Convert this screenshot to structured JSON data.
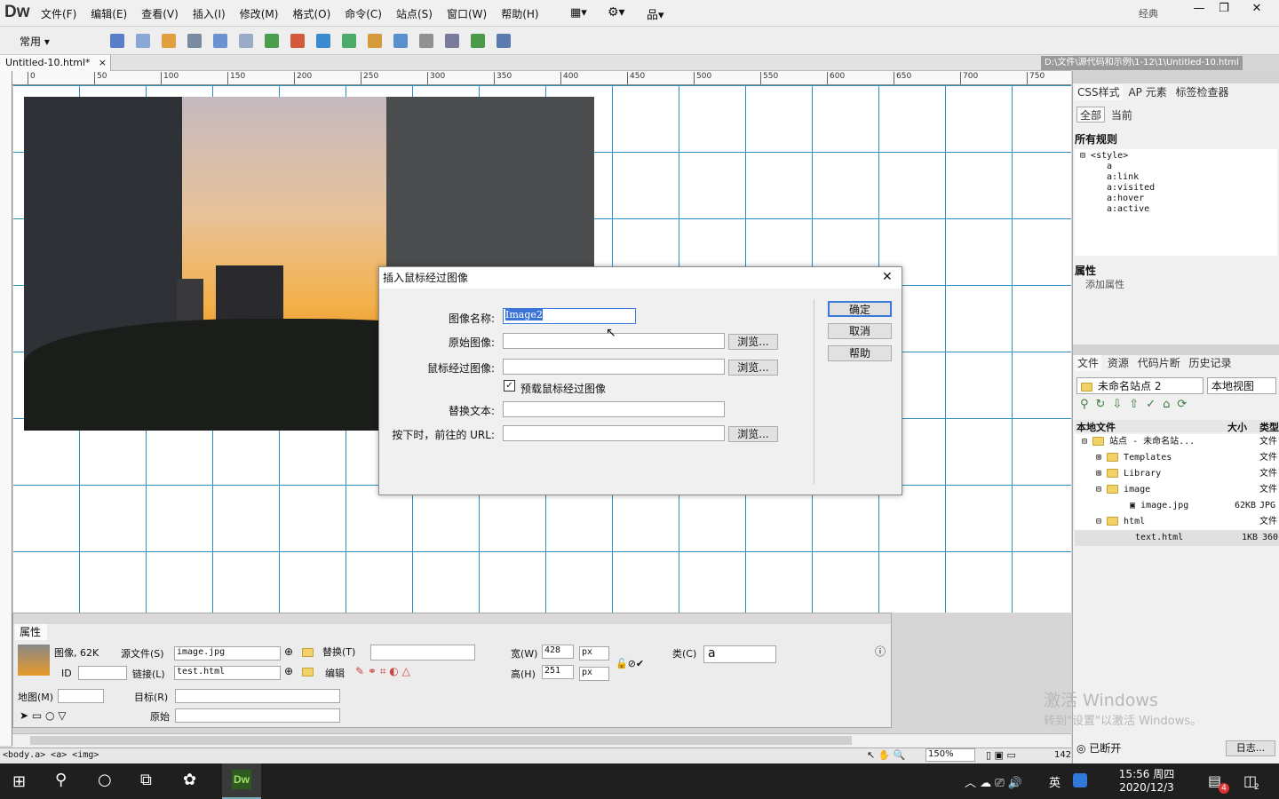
{
  "app": {
    "logo": "Dw",
    "layout": "经典",
    "win_min": "—",
    "win_max": "❐",
    "win_close": "✕"
  },
  "menu": [
    "文件(F)",
    "编辑(E)",
    "查看(V)",
    "插入(I)",
    "修改(M)",
    "格式(O)",
    "命令(C)",
    "站点(S)",
    "窗口(W)",
    "帮助(H)"
  ],
  "toolbar": {
    "category": "常用"
  },
  "document": {
    "tab": "Untitled-10.html*",
    "tab_close": "×",
    "path": "D:\\文件\\源代码和示例\\1-12\\1\\Untitled-10.html"
  },
  "ruler": [
    "0",
    "50",
    "100",
    "150",
    "200",
    "250",
    "300",
    "350",
    "400",
    "450",
    "500",
    "550",
    "600",
    "650",
    "700",
    "750"
  ],
  "dialog": {
    "title": "插入鼠标经过图像",
    "close": "✕",
    "fields": {
      "name_label": "图像名称:",
      "name_value": "Image2",
      "orig_label": "原始图像:",
      "over_label": "鼠标经过图像:",
      "preload_label": "预载鼠标经过图像",
      "alt_label": "替换文本:",
      "url_label": "按下时，前往的 URL:"
    },
    "browse": "浏览...",
    "ok": "确定",
    "cancel": "取消",
    "help": "帮助"
  },
  "props": {
    "title": "属性",
    "img_info": "图像, 62K",
    "src_label": "源文件(S)",
    "src": "image.jpg",
    "alt_label": "替换(T)",
    "w_label": "宽(W)",
    "w": "428",
    "h_label": "高(H)",
    "h": "251",
    "unit": "px",
    "class_label": "类(C)",
    "class": "a",
    "id_label": "ID",
    "link_label": "链接(L)",
    "link": "test.html",
    "edit_label": "编辑",
    "map_label": "地图(M)",
    "target_label": "目标(R)",
    "orig_label": "原始"
  },
  "css_panel": {
    "tabs": [
      "CSS样式",
      "AP 元素",
      "标签检查器"
    ],
    "mode": [
      "全部",
      "当前"
    ],
    "all_rules": "所有规则",
    "rules": [
      "<style>",
      "a",
      "a:link",
      "a:visited",
      "a:hover",
      "a:active"
    ],
    "props": "属性",
    "add_prop": "添加属性"
  },
  "files_panel": {
    "tabs": [
      "文件",
      "资源",
      "代码片断",
      "历史记录"
    ],
    "site": "未命名站点 2",
    "view": "本地视图",
    "headers": [
      "本地文件",
      "大小",
      "类型"
    ],
    "tree": [
      {
        "name": "站点 - 未命名站...",
        "size": "",
        "type": "文件"
      },
      {
        "name": "Templates",
        "size": "",
        "type": "文件"
      },
      {
        "name": "Library",
        "size": "",
        "type": "文件"
      },
      {
        "name": "image",
        "size": "",
        "type": "文件"
      },
      {
        "name": "image.jpg",
        "size": "62KB",
        "type": "JPG"
      },
      {
        "name": "html",
        "size": "",
        "type": "文件"
      },
      {
        "name": "text.html",
        "size": "1KB",
        "type": "360"
      }
    ],
    "status": "已断开",
    "log": "日志..."
  },
  "status": {
    "tags": "<body.a> <a> <img>",
    "zoom": "150%",
    "dims": "142"
  },
  "watermark": {
    "line1": "激活 Windows",
    "line2": "转到\"设置\"以激活 Windows。"
  },
  "taskbar": {
    "time": "15:56 周四",
    "date": "2020/12/3",
    "ime": "英",
    "notif": "4",
    "msg": "2"
  }
}
